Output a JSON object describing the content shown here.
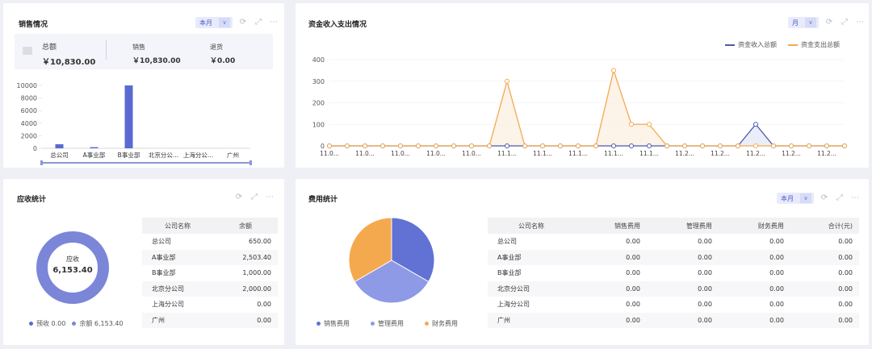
{
  "sales": {
    "title": "销售情况",
    "period": "本月",
    "summary": [
      {
        "label": "总额",
        "value": "￥10,830.00"
      },
      {
        "label": "销售",
        "value": "￥10,830.00"
      },
      {
        "label": "退货",
        "value": "￥0.00"
      }
    ],
    "chart_data": {
      "type": "bar",
      "categories": [
        "总公司",
        "A事业部",
        "B事业部",
        "北京分公...",
        "上海分公...",
        "广州"
      ],
      "values": [
        650,
        180,
        10000,
        0,
        0,
        0
      ],
      "ylim": [
        0,
        10000
      ],
      "yticks": [
        0,
        2000,
        4000,
        6000,
        8000,
        10000
      ],
      "color": "#5b6ad0"
    }
  },
  "cashflow": {
    "title": "资金收入支出情况",
    "period": "月",
    "chart_data": {
      "type": "line",
      "x_labels": [
        "11.0...",
        "11.0...",
        "11.0...",
        "11.0...",
        "11.0...",
        "11.1...",
        "11.1...",
        "11.1...",
        "11.1...",
        "11.1...",
        "11.2...",
        "11.2...",
        "11.2...",
        "11.2...",
        "11.2..."
      ],
      "ylim": [
        0,
        400
      ],
      "yticks": [
        0,
        100,
        200,
        300,
        400
      ],
      "series": [
        {
          "name": "资金收入总额",
          "color": "#4a5aa8",
          "values": [
            0,
            0,
            0,
            0,
            0,
            0,
            0,
            0,
            0,
            0,
            0,
            0,
            0,
            0,
            0,
            0,
            0,
            0,
            0,
            0,
            0,
            0,
            0,
            0,
            0,
            0,
            0,
            0,
            0,
            0
          ]
        },
        {
          "name": "资金支出总额",
          "color": "#f5a94e",
          "values": [
            0,
            0,
            0,
            0,
            0,
            0,
            0,
            0,
            0,
            0,
            300,
            0,
            0,
            0,
            0,
            0,
            350,
            100,
            100,
            0,
            0,
            0,
            0,
            0,
            0,
            0,
            0,
            0,
            0,
            0
          ]
        }
      ],
      "income_override": {
        "24": 100,
        "22": 0
      }
    }
  },
  "receivable": {
    "title": "应收统计",
    "center_label": "应收",
    "center_value": "6,153.40",
    "legend": [
      {
        "label": "预收 0.00",
        "color": "#5b6ad0"
      },
      {
        "label": "余额 6,153.40",
        "color": "#7b86d8"
      }
    ],
    "chart_data": {
      "type": "pie",
      "categories": [
        "预收",
        "余额"
      ],
      "values": [
        0,
        6153.4
      ]
    },
    "table": {
      "headers": [
        "公司名称",
        "余额"
      ],
      "rows": [
        [
          "总公司",
          "650.00"
        ],
        [
          "A事业部",
          "2,503.40"
        ],
        [
          "B事业部",
          "1,000.00"
        ],
        [
          "北京分公司",
          "2,000.00"
        ],
        [
          "上海分公司",
          "0.00"
        ],
        [
          "广州",
          "0.00"
        ]
      ]
    }
  },
  "expense": {
    "title": "费用统计",
    "period": "本月",
    "legend": [
      {
        "label": "销售费用",
        "color": "#6172d4"
      },
      {
        "label": "管理费用",
        "color": "#8e9ae6"
      },
      {
        "label": "财务费用",
        "color": "#f5a94e"
      }
    ],
    "chart_data": {
      "type": "pie",
      "categories": [
        "销售费用",
        "管理费用",
        "财务费用"
      ],
      "values": [
        1,
        1,
        1
      ],
      "colors": [
        "#6172d4",
        "#8e9ae6",
        "#f5a94e"
      ]
    },
    "table": {
      "headers": [
        "公司名称",
        "销售费用",
        "管理费用",
        "财务费用",
        "合计(元)"
      ],
      "rows": [
        [
          "总公司",
          "0.00",
          "0.00",
          "0.00",
          "0.00"
        ],
        [
          "A事业部",
          "0.00",
          "0.00",
          "0.00",
          "0.00"
        ],
        [
          "B事业部",
          "0.00",
          "0.00",
          "0.00",
          "0.00"
        ],
        [
          "北京分公司",
          "0.00",
          "0.00",
          "0.00",
          "0.00"
        ],
        [
          "上海分公司",
          "0.00",
          "0.00",
          "0.00",
          "0.00"
        ],
        [
          "广州",
          "0.00",
          "0.00",
          "0.00",
          "0.00"
        ]
      ]
    }
  }
}
